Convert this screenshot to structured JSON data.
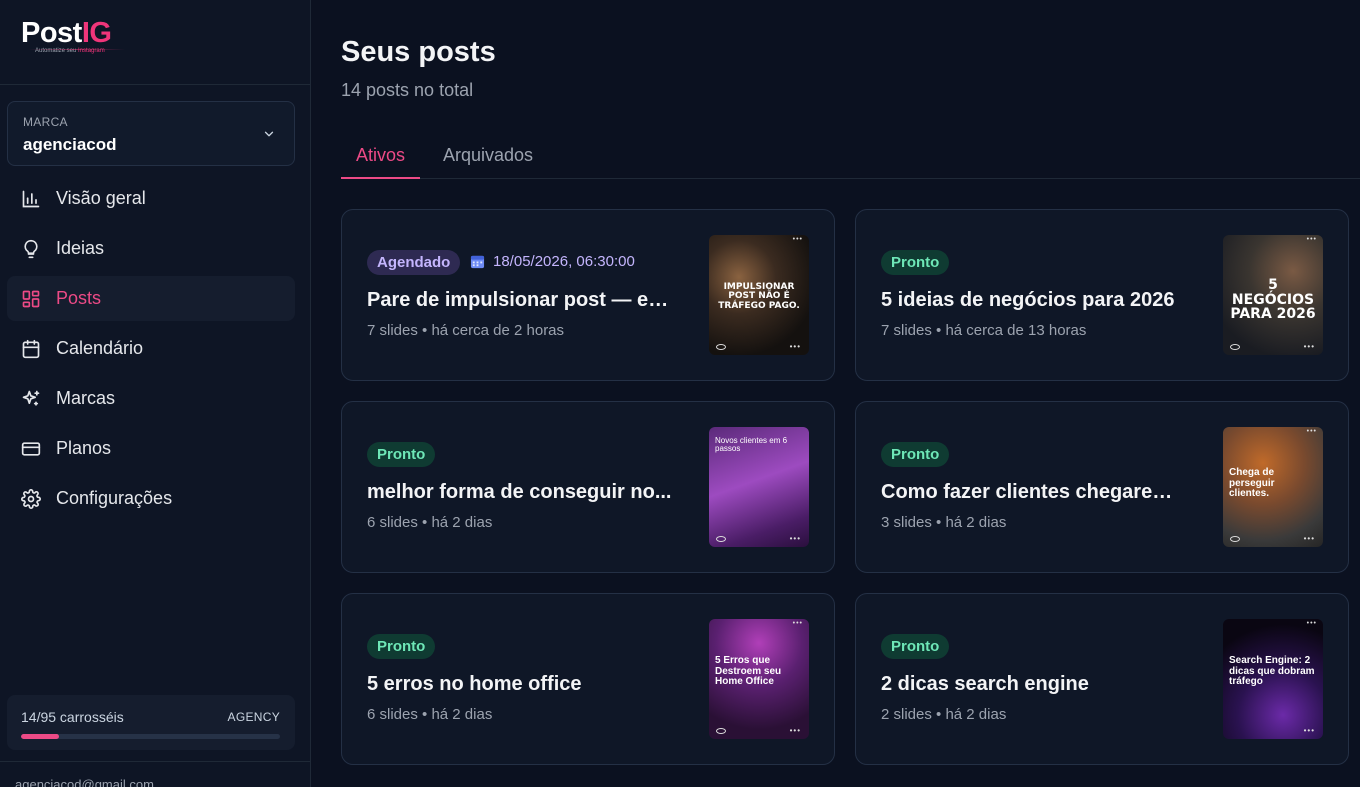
{
  "app": {
    "logo_main": "Post",
    "logo_accent": "IG",
    "logo_tagline": "Automatize seu",
    "logo_tagline_accent": "Instagram"
  },
  "sidebar": {
    "brand_label": "MARCA",
    "brand_value": "agenciacod",
    "items": [
      {
        "label": "Visão geral",
        "icon": "bar-chart-icon"
      },
      {
        "label": "Ideias",
        "icon": "lightbulb-icon"
      },
      {
        "label": "Posts",
        "icon": "grid-icon",
        "active": true
      },
      {
        "label": "Calendário",
        "icon": "calendar-icon"
      },
      {
        "label": "Marcas",
        "icon": "sparkles-icon"
      },
      {
        "label": "Planos",
        "icon": "credit-card-icon"
      },
      {
        "label": "Configurações",
        "icon": "gear-icon"
      }
    ],
    "usage": {
      "count_label": "14/95 carrosséis",
      "plan": "AGENCY",
      "fraction": 0.147
    },
    "user_email": "agenciacod@gmail.com"
  },
  "main": {
    "title": "Seus posts",
    "subtitle": "14 posts no total",
    "tabs": [
      {
        "label": "Ativos",
        "active": true
      },
      {
        "label": "Arquivados",
        "active": false
      }
    ],
    "posts": [
      {
        "status": "Agendado",
        "schedule": "18/05/2026, 06:30:00",
        "title": "Pare de impulsionar post — e c...",
        "meta": "7 slides • há cerca de 2 horas",
        "thumb_text": "IMPULSIONAR POST NÃO É TRÁFEGO PAGO."
      },
      {
        "status": "Pronto",
        "title": "5 ideias de negócios para 2026",
        "meta": "7 slides • há cerca de 13 horas",
        "thumb_text": "5 NEGÓCIOS PARA 2026"
      },
      {
        "status": "Pronto",
        "title": "melhor forma de conseguir no...",
        "meta": "6 slides • há 2 dias",
        "thumb_text": "Novos clientes em 6 passos"
      },
      {
        "status": "Pronto",
        "title": "Como fazer clientes chegarem ...",
        "meta": "3 slides • há 2 dias",
        "thumb_text": "Chega de perseguir clientes."
      },
      {
        "status": "Pronto",
        "title": "5 erros no home office",
        "meta": "6 slides • há 2 dias",
        "thumb_text": "5 Erros que Destroem seu Home Office"
      },
      {
        "status": "Pronto",
        "title": "2 dicas search engine",
        "meta": "2 slides • há 2 dias",
        "thumb_text": "Search Engine: 2 dicas que dobram tráfego"
      }
    ]
  },
  "colors": {
    "accent": "#ec4a86",
    "background": "#0b1120",
    "scheduled": "#c4b5fd",
    "ready": "#6ee7b7"
  }
}
